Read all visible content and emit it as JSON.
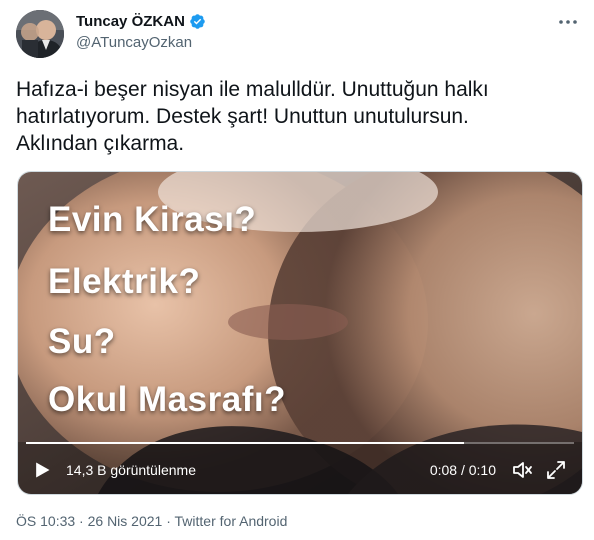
{
  "author": {
    "name": "Tuncay ÖZKAN",
    "handle": "@ATuncayOzkan"
  },
  "tweet": {
    "text": "Hafıza-i beşer nisyan ile malulldür. Unuttuğun halkı\nhatırlatıyorum. Destek şart! Unuttun unutulursun.\nAklından çıkarma."
  },
  "video": {
    "overlay_lines": [
      "Evin Kirası?",
      "Elektrik?",
      "Su?",
      "Okul Masrafı?"
    ],
    "views": "14,3 B görüntülenme",
    "time": "0:08 / 0:10",
    "progress": 0.8
  },
  "meta": {
    "time": "ÖS 10:33",
    "date": "26 Nis 2021",
    "source": "Twitter for Android",
    "separator": "·"
  },
  "colors": {
    "text": "#0f1419",
    "secondary": "#536471",
    "verified": "#1d9bf0"
  }
}
